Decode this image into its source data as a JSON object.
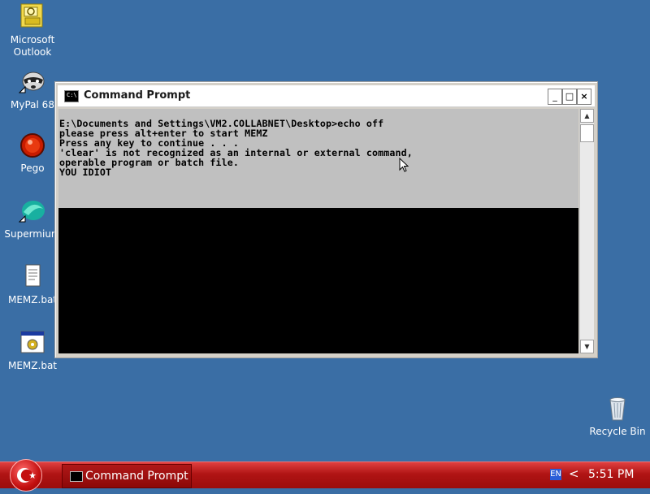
{
  "desktop": {
    "icons": [
      {
        "label": "Microsoft\nOutlook"
      },
      {
        "label": "MyPal 68"
      },
      {
        "label": "Pego"
      },
      {
        "label": "Supermium"
      },
      {
        "label": "MEMZ.bat"
      },
      {
        "label": "MEMZ.bat"
      },
      {
        "label": "Recycle Bin"
      }
    ]
  },
  "window": {
    "title": "Command Prompt",
    "icon_text": "C:\\",
    "controls": {
      "minimize": "_",
      "maximize": "□",
      "close": "×"
    },
    "console_lines": [
      "E:\\Documents and Settings\\VM2.COLLABNET\\Desktop>echo off",
      "please press alt+enter to start MEMZ",
      "Press any key to continue . . .",
      "'clear' is not recognized as an internal or external command,",
      "operable program or batch file.",
      "YOU IDIOT"
    ],
    "scroll": {
      "up": "▲",
      "down": "▼"
    }
  },
  "taskbar": {
    "task_label": "Command Prompt",
    "language": "EN",
    "tray_chevron": "<",
    "clock": "5:51 PM"
  },
  "colors": {
    "desktop": "#3a6ea5",
    "taskbar": "#b01414",
    "console_bg": "#000000",
    "console_text_area": "#c0c0c0"
  }
}
